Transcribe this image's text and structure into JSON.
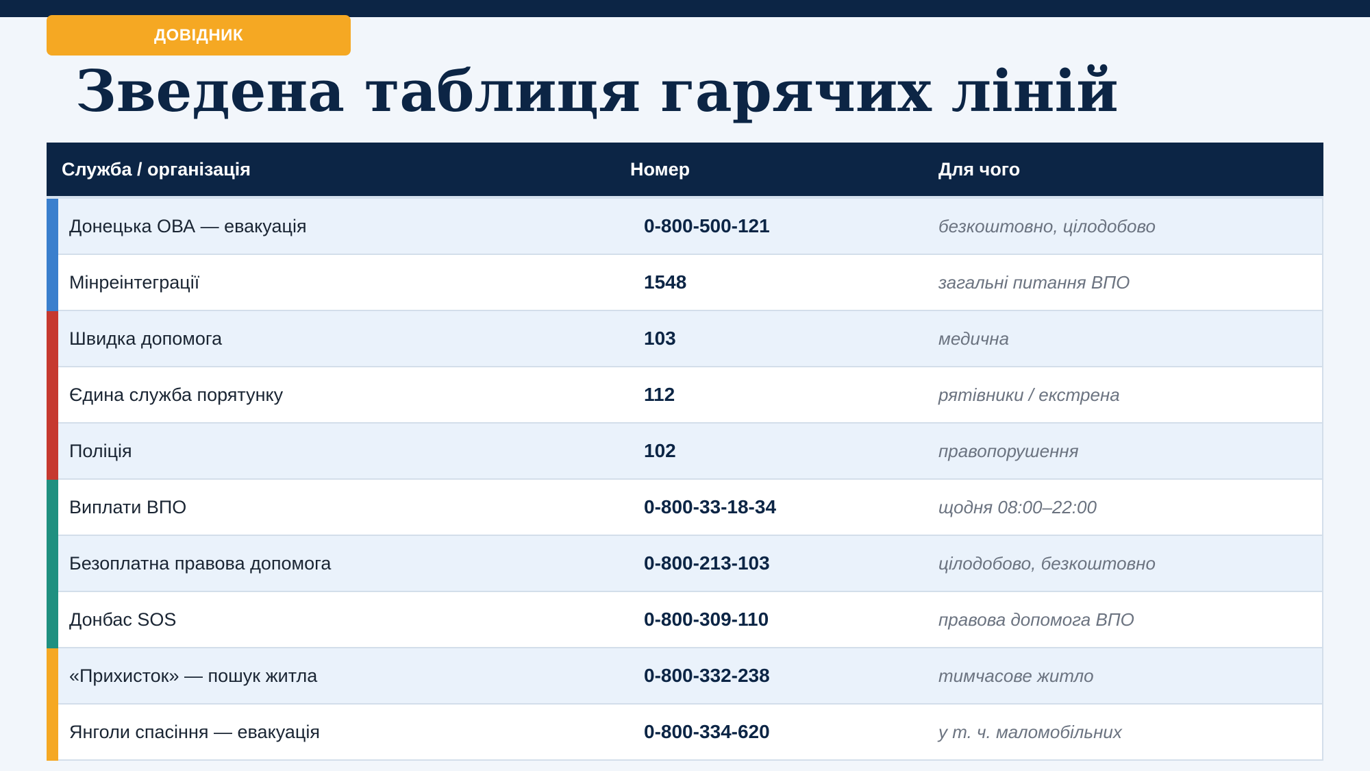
{
  "badge": "ДОВІДНИК",
  "title": "Зведена таблиця гарячих ліній",
  "table": {
    "headers": {
      "service": "Служба / організація",
      "number": "Номер",
      "purpose": "Для чого"
    },
    "category_colors": {
      "blue": "#3a7fcd",
      "red": "#c6392f",
      "green": "#1f9080",
      "orange": "#f5a823"
    },
    "rows": [
      {
        "service": "Донецька ОВА — евакуація",
        "number": "0-800-500-121",
        "purpose": "безкоштовно, цілодобово",
        "accent": "#3a7fcd"
      },
      {
        "service": "Мінреінтеграції",
        "number": "1548",
        "purpose": "загальні питання ВПО",
        "accent": "#3a7fcd"
      },
      {
        "service": "Швидка допомога",
        "number": "103",
        "purpose": "медична",
        "accent": "#c6392f"
      },
      {
        "service": "Єдина служба порятунку",
        "number": "112",
        "purpose": "рятівники / екстрена",
        "accent": "#c6392f"
      },
      {
        "service": "Поліція",
        "number": "102",
        "purpose": "правопорушення",
        "accent": "#c6392f"
      },
      {
        "service": "Виплати ВПО",
        "number": "0-800-33-18-34",
        "purpose": "щодня 08:00–22:00",
        "accent": "#1f9080"
      },
      {
        "service": "Безоплатна правова допомога",
        "number": "0-800-213-103",
        "purpose": "цілодобово, безкоштовно",
        "accent": "#1f9080"
      },
      {
        "service": "Донбас SOS",
        "number": "0-800-309-110",
        "purpose": "правова допомога ВПО",
        "accent": "#1f9080"
      },
      {
        "service": "«Прихисток» — пошук житла",
        "number": "0-800-332-238",
        "purpose": "тимчасове житло",
        "accent": "#f5a823"
      },
      {
        "service": "Янголи спасіння — евакуація",
        "number": "0-800-334-620",
        "purpose": "у т. ч. маломобільних",
        "accent": "#f5a823"
      }
    ]
  }
}
